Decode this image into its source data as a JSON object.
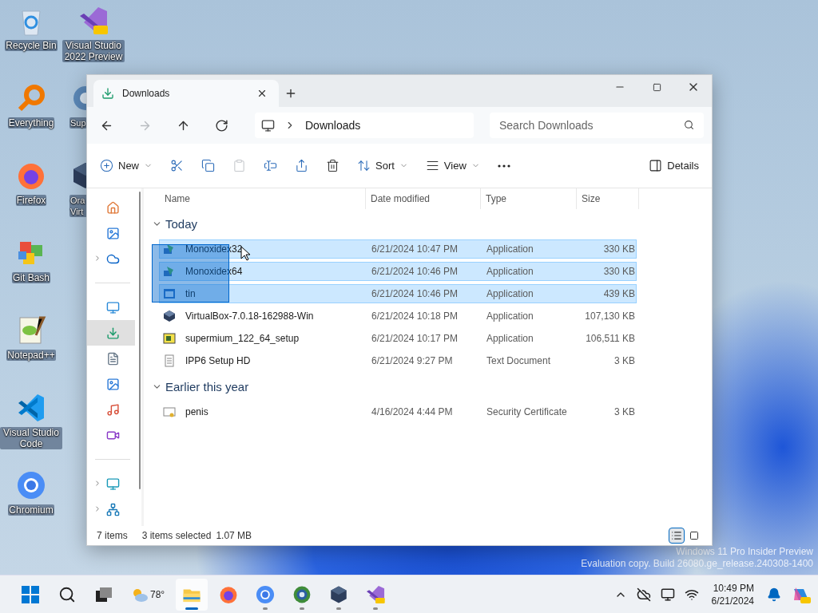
{
  "desktop": {
    "icons": [
      {
        "label": "Recycle Bin",
        "kind": "recycle",
        "cut": false
      },
      {
        "label": "Everything",
        "kind": "everything",
        "cut": false
      },
      {
        "label": "Firefox",
        "kind": "firefox",
        "cut": false
      },
      {
        "label": "Git Bash",
        "kind": "git",
        "cut": false
      },
      {
        "label": "Notepad++",
        "kind": "notepad",
        "cut": false
      },
      {
        "label": "Visual Studio Code",
        "kind": "vscode",
        "cut": false
      },
      {
        "label": "Chromium",
        "kind": "chromium",
        "cut": false
      },
      {
        "label": "Visual Studio 2022 Preview",
        "kind": "vs",
        "cut": false
      },
      {
        "label": "Sup",
        "kind": "supermium",
        "cut": true
      },
      {
        "label": "Ora Virt",
        "kind": "vbox",
        "cut": true
      }
    ],
    "watermark": [
      "Windows 11 Pro Insider Preview",
      "Evaluation copy. Build 26080.ge_release.240308-1400"
    ]
  },
  "window": {
    "tab": {
      "title": "Downloads",
      "selected": true
    },
    "nav": [
      {
        "kind": "back",
        "disabled": false
      },
      {
        "kind": "forward",
        "disabled": true
      },
      {
        "kind": "up",
        "disabled": false
      },
      {
        "kind": "refresh",
        "disabled": false
      }
    ],
    "address": "Downloads",
    "search": {
      "placeholder": "Search Downloads"
    },
    "toolbar": [
      {
        "kind": "new",
        "label": "New",
        "disabled": false
      },
      {
        "kind": "cut",
        "disabled": false
      },
      {
        "kind": "copy",
        "disabled": false
      },
      {
        "kind": "paste",
        "disabled": true
      },
      {
        "kind": "rename",
        "disabled": false
      },
      {
        "kind": "share",
        "disabled": false
      },
      {
        "kind": "delete",
        "disabled": false
      },
      {
        "kind": "sort",
        "label": "Sort",
        "disabled": false
      },
      {
        "kind": "view",
        "label": "View",
        "disabled": false
      },
      {
        "kind": "more",
        "disabled": false
      }
    ],
    "details_button": "Details",
    "sidebar": {
      "items": [
        {
          "kind": "home",
          "expandable": false,
          "selected": false
        },
        {
          "kind": "gallery",
          "expandable": false,
          "selected": false
        },
        {
          "kind": "cloud",
          "expandable": true,
          "selected": false
        },
        {
          "kind": "divider"
        },
        {
          "kind": "desktop",
          "expandable": false,
          "selected": false
        },
        {
          "kind": "downloads",
          "expandable": false,
          "selected": true
        },
        {
          "kind": "documents",
          "expandable": false,
          "selected": false
        },
        {
          "kind": "pictures",
          "expandable": false,
          "selected": false
        },
        {
          "kind": "music",
          "expandable": false,
          "selected": false
        },
        {
          "kind": "videos",
          "expandable": false,
          "selected": false
        },
        {
          "kind": "divider"
        },
        {
          "kind": "pc",
          "expandable": true,
          "selected": false
        },
        {
          "kind": "network",
          "expandable": true,
          "selected": false
        }
      ]
    },
    "columns": [
      "Name",
      "Date modified",
      "Type",
      "Size"
    ],
    "groups": [
      {
        "title": "Today",
        "expanded": true,
        "rows": [
          {
            "name": "Monoxidex32",
            "date": "6/21/2024 10:47 PM",
            "type": "Application",
            "size": "330 KB",
            "kind": "app",
            "selected": true
          },
          {
            "name": "Monoxidex64",
            "date": "6/21/2024 10:46 PM",
            "type": "Application",
            "size": "330 KB",
            "kind": "app",
            "selected": true
          },
          {
            "name": "tin",
            "date": "6/21/2024 10:46 PM",
            "type": "Application",
            "size": "439 KB",
            "kind": "window",
            "selected": true
          },
          {
            "name": "VirtualBox-7.0.18-162988-Win",
            "date": "6/21/2024 10:18 PM",
            "type": "Application",
            "size": "107,130 KB",
            "kind": "vbox",
            "selected": false
          },
          {
            "name": "supermium_122_64_setup",
            "date": "6/21/2024 10:17 PM",
            "type": "Application",
            "size": "106,511 KB",
            "kind": "installer",
            "selected": false
          },
          {
            "name": "IPP6 Setup HD",
            "date": "6/21/2024 9:27 PM",
            "type": "Text Document",
            "size": "3 KB",
            "kind": "text",
            "selected": false
          }
        ]
      },
      {
        "title": "Earlier this year",
        "expanded": true,
        "rows": [
          {
            "name": "penis",
            "date": "4/16/2024 4:44 PM",
            "type": "Security Certificate",
            "size": "3 KB",
            "kind": "cert",
            "selected": false
          }
        ]
      }
    ],
    "status": {
      "count": "7 items",
      "selection": "3 items selected",
      "size": "1.07 MB"
    },
    "views": [
      {
        "kind": "details",
        "selected": true
      },
      {
        "kind": "tiles",
        "selected": false
      }
    ]
  },
  "taskbar": {
    "apps": [
      {
        "kind": "explorer",
        "selected": true,
        "running": true
      },
      {
        "kind": "firefox",
        "selected": false,
        "running": false
      },
      {
        "kind": "chromium",
        "selected": false,
        "running": true
      },
      {
        "kind": "globe",
        "selected": false,
        "running": true
      },
      {
        "kind": "vbox",
        "selected": false,
        "running": true
      },
      {
        "kind": "vs",
        "selected": false,
        "running": true
      }
    ],
    "weather": "78°",
    "time": "10:49 PM",
    "date": "6/21/2024"
  }
}
